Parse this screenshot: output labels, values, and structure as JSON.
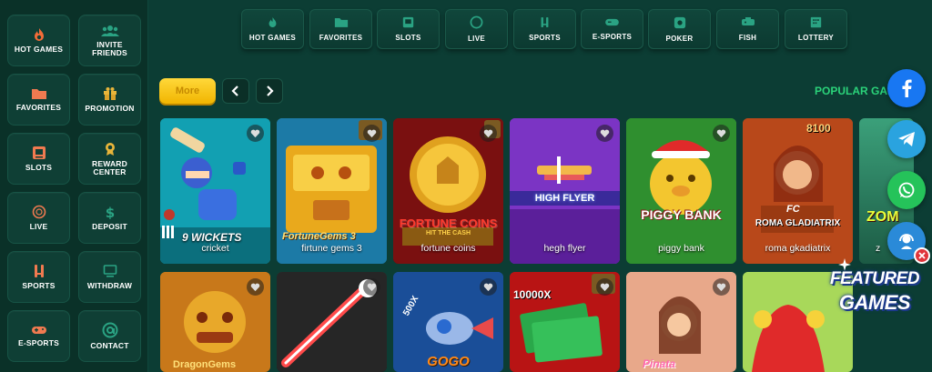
{
  "sidebar": {
    "items": [
      {
        "label": "HOT GAMES",
        "icon": "flame-icon"
      },
      {
        "label": "INVITE FRIENDS",
        "icon": "users-icon"
      },
      {
        "label": "FAVORITES",
        "icon": "folder-icon"
      },
      {
        "label": "PROMOTION",
        "icon": "gift-icon"
      },
      {
        "label": "SLOTS",
        "icon": "slot-machine-icon"
      },
      {
        "label": "REWARD CENTER",
        "icon": "medal-icon"
      },
      {
        "label": "LIVE",
        "icon": "live-ball-icon"
      },
      {
        "label": "DEPOSIT",
        "icon": "dollar-icon"
      },
      {
        "label": "SPORTS",
        "icon": "sports-icon"
      },
      {
        "label": "WITHDRAW",
        "icon": "monitor-icon"
      },
      {
        "label": "E-SPORTS",
        "icon": "gamepad-icon"
      },
      {
        "label": "CONTACT",
        "icon": "at-sign-icon"
      }
    ]
  },
  "topnav": {
    "items": [
      {
        "label": "HOT GAMES",
        "icon": "flame-icon"
      },
      {
        "label": "FAVORITES",
        "icon": "folder-icon"
      },
      {
        "label": "SLOTS",
        "icon": "slot-machine-icon"
      },
      {
        "label": "LIVE",
        "icon": "live-ball-icon"
      },
      {
        "label": "SPORTS",
        "icon": "sports-icon"
      },
      {
        "label": "E-SPORTS",
        "icon": "gamepad-icon"
      },
      {
        "label": "POKER",
        "icon": "poker-icon"
      },
      {
        "label": "FISH",
        "icon": "fish-icon"
      },
      {
        "label": "LOTTERY",
        "icon": "lottery-icon"
      }
    ]
  },
  "controls": {
    "more_label": "More",
    "section_title": "POPULAR GAMES"
  },
  "games": [
    {
      "name": "cricket",
      "art_text": "9 WICKETS"
    },
    {
      "name": "firtune gems 3",
      "art_text": "FortuneGems 3"
    },
    {
      "name": "fortune coins",
      "art_text": "FORTUNE COINS",
      "art_sub": "HIT THE CASH"
    },
    {
      "name": "hegh flyer",
      "art_text": "HIGH FLYER"
    },
    {
      "name": "piggy bank",
      "art_text": "PIGGY BANK"
    },
    {
      "name": "roma gkadiatrix",
      "art_text": "ROMA GLADIATRIX",
      "art_badge": "FC",
      "art_top": "8100"
    },
    {
      "name": "z",
      "art_text": "ZOM"
    },
    {
      "name": "",
      "art_text": "DragonGems"
    },
    {
      "name": "",
      "art_text": ""
    },
    {
      "name": "",
      "art_text": "GOGO",
      "art_top": "500X"
    },
    {
      "name": "",
      "art_text": "",
      "art_top": "10000X"
    },
    {
      "name": "",
      "art_text": "Pinata"
    },
    {
      "name": "",
      "art_text": ""
    }
  ],
  "featured": {
    "line1": "FEATURED",
    "line2": "GAMES"
  },
  "colors": {
    "background": "#0c3d34",
    "accent_green": "#2bd37a",
    "more_yellow": "#f6c10f",
    "facebook": "#1877f2",
    "telegram": "#2aa3df",
    "whatsapp": "#25c35a"
  }
}
